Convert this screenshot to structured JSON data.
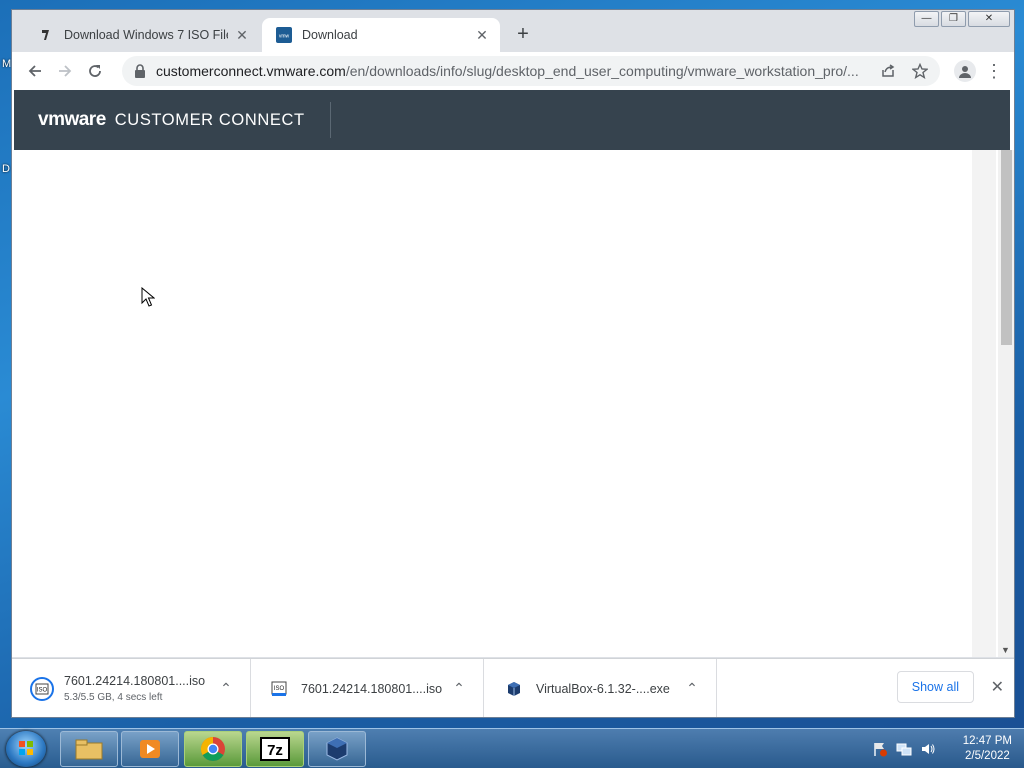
{
  "desktop": {
    "edge_letters": [
      "M",
      "D"
    ]
  },
  "window": {
    "controls": [
      "minimize",
      "maximize",
      "close"
    ]
  },
  "tabs": [
    {
      "title": "Download Windows 7 ISO File (U",
      "active": false
    },
    {
      "title": "Download",
      "active": true
    }
  ],
  "toolbar": {
    "url_host": "customerconnect.vmware.com",
    "url_path": "/en/downloads/info/slug/desktop_end_user_computing/vmware_workstation_pro/..."
  },
  "page": {
    "brand": "vmware",
    "product": "CUSTOMER CONNECT"
  },
  "downloads": [
    {
      "name": "7601.24214.180801....iso",
      "status": "5.3/5.5 GB, 4 secs left",
      "icon": "iso-disc-icon"
    },
    {
      "name": "7601.24214.180801....iso",
      "status": "",
      "icon": "iso-file-icon"
    },
    {
      "name": "VirtualBox-6.1.32-....exe",
      "status": "",
      "icon": "virtualbox-icon"
    }
  ],
  "shelf": {
    "show_all": "Show all"
  },
  "taskbar": {
    "time": "12:47 PM",
    "date": "2/5/2022"
  }
}
